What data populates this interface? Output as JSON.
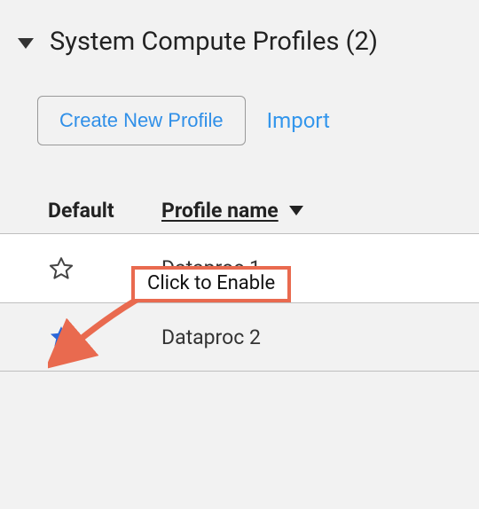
{
  "header": {
    "title": "System Compute Profiles (2)"
  },
  "actions": {
    "create_label": "Create New Profile",
    "import_label": "Import"
  },
  "table": {
    "columns": {
      "default": "Default",
      "name": "Profile name"
    },
    "rows": [
      {
        "name": "Dataproc 1",
        "default": false
      },
      {
        "name": "Dataproc 2",
        "default": true
      }
    ]
  },
  "annotation": {
    "label": "Click to Enable"
  },
  "colors": {
    "accent_blue": "#2f8fe8",
    "star_blue": "#2a66d8",
    "callout": "#e96a4f"
  }
}
